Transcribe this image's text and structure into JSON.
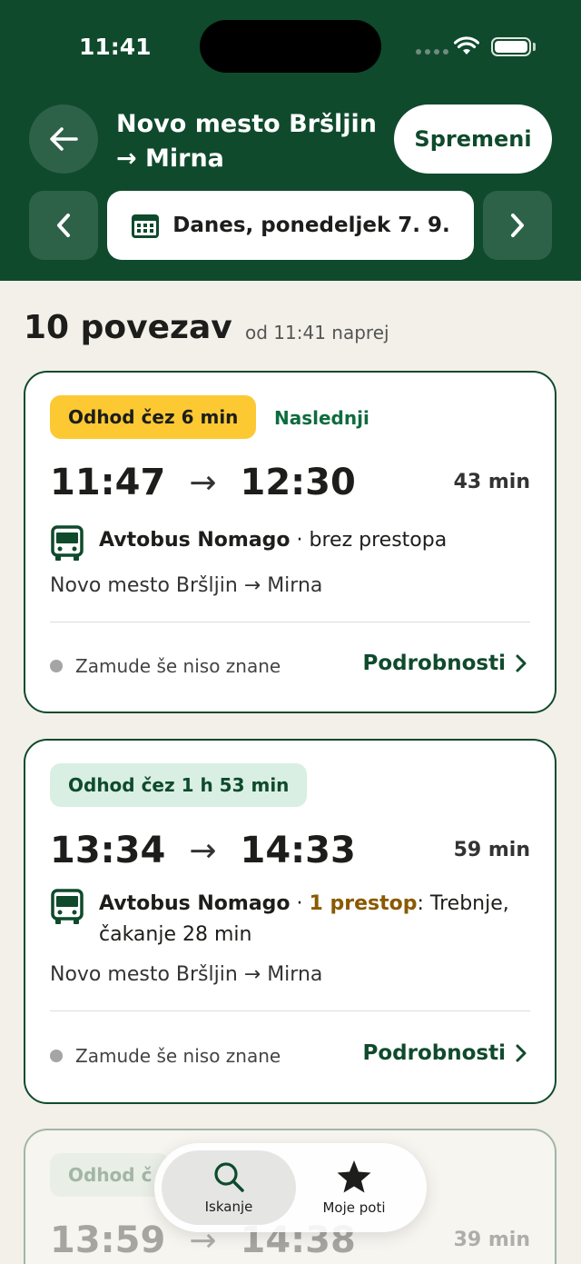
{
  "status": {
    "time": "11:41"
  },
  "header": {
    "route_line1": "Novo mesto Bršljin",
    "route_line2": "→ Mirna",
    "change_label": "Spremeni",
    "date_label": "Danes, ponedeljek 7. 9."
  },
  "summary": {
    "title": "10 povezav",
    "subtitle": "od 11:41 naprej"
  },
  "connections": [
    {
      "badge": "Odhod čez 6 min",
      "next_label": "Naslednji",
      "departure": "11:47",
      "arrival": "12:30",
      "duration": "43 min",
      "operator": "Avtobus Nomago",
      "transfer_text": " · brez prestopa",
      "stops": "Novo mesto Bršljin → Mirna",
      "delay_status": "Zamude še niso znane",
      "details_label": "Podrobnosti"
    },
    {
      "badge": "Odhod čez 1 h 53 min",
      "departure": "13:34",
      "arrival": "14:33",
      "duration": "59 min",
      "operator": "Avtobus Nomago",
      "transfer_sep": " · ",
      "transfer_highlight": "1 prestop",
      "transfer_rest": ": Trebnje, čakanje 28 min",
      "stops": "Novo mesto Bršljin → Mirna",
      "delay_status": "Zamude še niso znane",
      "details_label": "Podrobnosti"
    },
    {
      "badge": "Odhod č",
      "departure": "13:59",
      "arrival": "14:38",
      "duration": "39 min"
    }
  ],
  "tabs": [
    {
      "label": "Iskanje",
      "icon": "search-icon"
    },
    {
      "label": "Moje poti",
      "icon": "star-icon"
    }
  ],
  "colors": {
    "brand": "#0f4a2c",
    "badge_yellow": "#fcc933",
    "badge_green": "#d9efe3",
    "transfer": "#8a5a00"
  }
}
